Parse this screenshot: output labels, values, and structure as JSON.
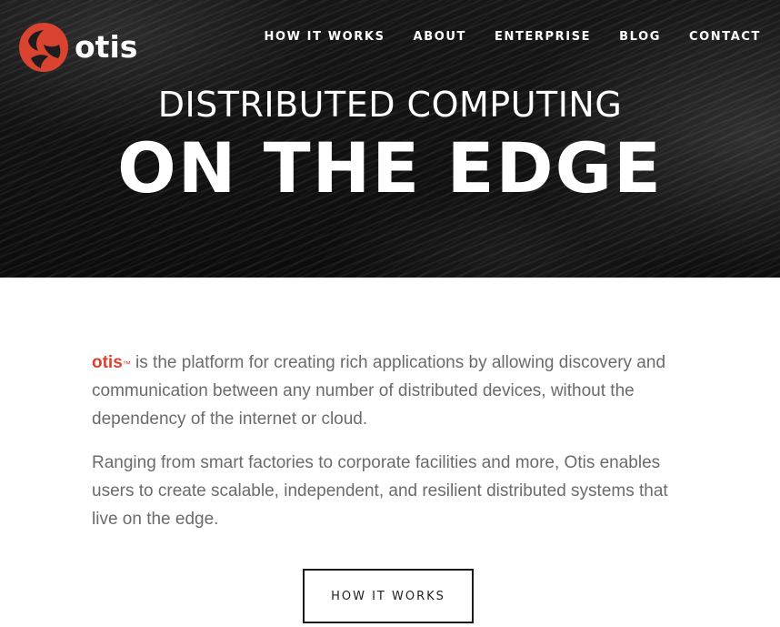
{
  "brand": {
    "logo_text": "otis",
    "logo_icon": "otis-logo-icon",
    "accent_color": "#d9432f"
  },
  "nav": {
    "items": [
      {
        "label": "HOW IT WORKS"
      },
      {
        "label": "ABOUT"
      },
      {
        "label": "ENTERPRISE"
      },
      {
        "label": "BLOG"
      },
      {
        "label": "CONTACT"
      }
    ]
  },
  "hero": {
    "line1": "DISTRIBUTED COMPUTING",
    "line2": "ON THE EDGE"
  },
  "intro": {
    "brand_word": "otis",
    "trademark": "™",
    "paragraph1_rest": " is the platform for creating rich applications by allowing discovery and communication between any number of distributed devices, without the dependency of the internet or cloud.",
    "paragraph2": "Ranging from smart factories to corporate facilities and more, Otis enables users to create scalable, independent, and resilient distributed systems that live on the edge."
  },
  "cta": {
    "label": "HOW IT WORKS"
  }
}
